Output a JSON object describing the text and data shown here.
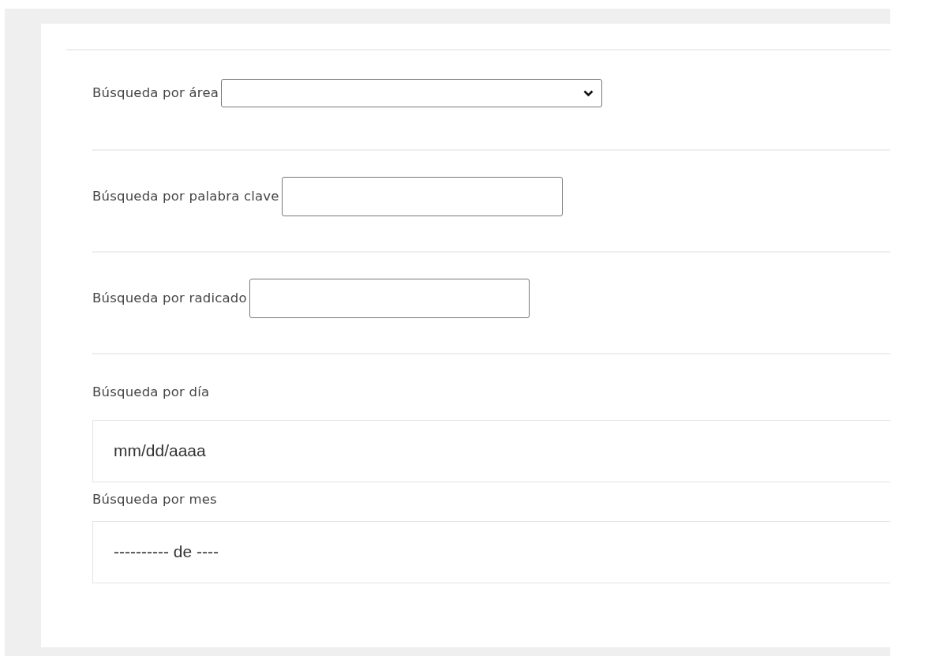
{
  "fields": [
    {
      "kind": "select",
      "label": "Búsqueda por área"
    },
    {
      "kind": "text",
      "label": "Búsqueda por palabra clave"
    },
    {
      "kind": "text",
      "label": "Búsqueda por radicado"
    },
    {
      "kind": "date",
      "label": "Búsqueda por día",
      "placeholder": "mm/dd/aaaa"
    },
    {
      "kind": "month",
      "label": "Búsqueda por mes",
      "placeholder": "---------- de ----"
    }
  ]
}
